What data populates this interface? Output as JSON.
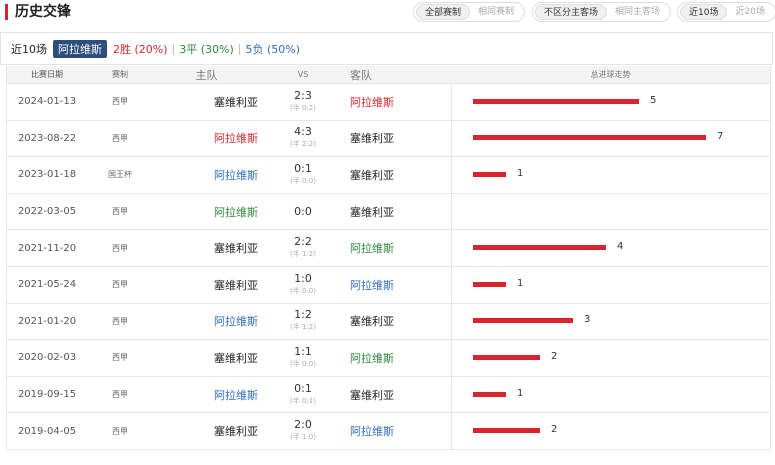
{
  "title": "历史交锋",
  "filters": {
    "group1": [
      "全部赛制",
      "相同赛制"
    ],
    "group2": [
      "不区分主客场",
      "相同主客场"
    ],
    "group3": [
      "近10场",
      "近20场"
    ]
  },
  "summary": {
    "label": "近10场",
    "team": "阿拉维斯",
    "win": "2胜 (20%)",
    "draw": "3平 (30%)",
    "lose": "5负 (50%)",
    "sep": "|"
  },
  "columns": {
    "date": "比赛日期",
    "comp": "赛制",
    "home": "主队",
    "vs": "VS",
    "away": "客队",
    "trend": "总进球走势"
  },
  "colors": {
    "accent": "#d8242d",
    "team_badge": "#2d4d7c",
    "draw": "#2a8a3a",
    "lose": "#2f6bc7"
  },
  "matches": [
    {
      "date": "2024-01-13",
      "comp": "西甲",
      "home": "塞维利亚",
      "home_color": "dark",
      "ft": "2:3",
      "ht": "(半 0:2)",
      "away": "阿拉维斯",
      "away_color": "red",
      "total": "5"
    },
    {
      "date": "2023-08-22",
      "comp": "西甲",
      "home": "阿拉维斯",
      "home_color": "red",
      "ft": "4:3",
      "ht": "(半 2:2)",
      "away": "塞维利亚",
      "away_color": "dark",
      "total": "7"
    },
    {
      "date": "2023-01-18",
      "comp": "国王杯",
      "home": "阿拉维斯",
      "home_color": "blue",
      "ft": "0:1",
      "ht": "(半 0:0)",
      "away": "塞维利亚",
      "away_color": "dark",
      "total": "1"
    },
    {
      "date": "2022-03-05",
      "comp": "西甲",
      "home": "阿拉维斯",
      "home_color": "green",
      "ft": "0:0",
      "ht": "",
      "away": "塞维利亚",
      "away_color": "dark",
      "total": "0"
    },
    {
      "date": "2021-11-20",
      "comp": "西甲",
      "home": "塞维利亚",
      "home_color": "dark",
      "ft": "2:2",
      "ht": "(半 1:2)",
      "away": "阿拉维斯",
      "away_color": "green",
      "total": "4"
    },
    {
      "date": "2021-05-24",
      "comp": "西甲",
      "home": "塞维利亚",
      "home_color": "dark",
      "ft": "1:0",
      "ht": "(半 0:0)",
      "away": "阿拉维斯",
      "away_color": "blue",
      "total": "1"
    },
    {
      "date": "2021-01-20",
      "comp": "西甲",
      "home": "阿拉维斯",
      "home_color": "blue",
      "ft": "1:2",
      "ht": "(半 1:2)",
      "away": "塞维利亚",
      "away_color": "dark",
      "total": "3"
    },
    {
      "date": "2020-02-03",
      "comp": "西甲",
      "home": "塞维利亚",
      "home_color": "dark",
      "ft": "1:1",
      "ht": "(半 0:0)",
      "away": "阿拉维斯",
      "away_color": "green",
      "total": "2"
    },
    {
      "date": "2019-09-15",
      "comp": "西甲",
      "home": "阿拉维斯",
      "home_color": "blue",
      "ft": "0:1",
      "ht": "(半 0:1)",
      "away": "塞维利亚",
      "away_color": "dark",
      "total": "1"
    },
    {
      "date": "2019-04-05",
      "comp": "西甲",
      "home": "塞维利亚",
      "home_color": "dark",
      "ft": "2:0",
      "ht": "(半 1:0)",
      "away": "阿拉维斯",
      "away_color": "blue",
      "total": "2"
    }
  ]
}
